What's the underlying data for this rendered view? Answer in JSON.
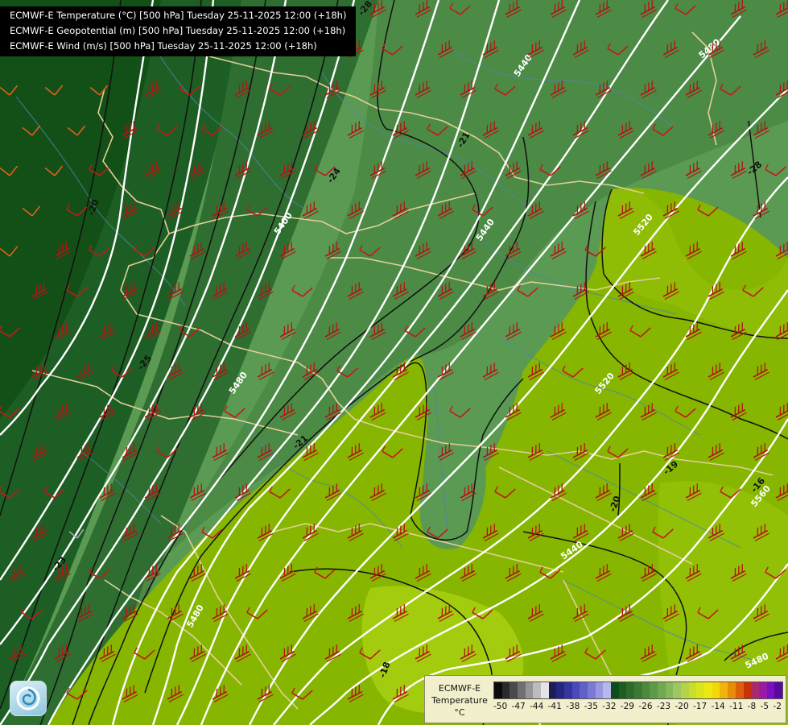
{
  "header": {
    "lines": [
      "ECMWF-E Temperature (°C) [500 hPa] Tuesday 25-11-2025 12:00 (+18h)",
      "ECMWF-E Geopotential (m) [500 hPa] Tuesday 25-11-2025 12:00 (+18h)",
      "ECMWF-E Wind (m/s) [500 hPa] Tuesday 25-11-2025 12:00 (+18h)"
    ]
  },
  "legend": {
    "title": [
      "ECMWF-E",
      "Temperature",
      "°C"
    ],
    "ticks": [
      "-50",
      "-47",
      "-44",
      "-41",
      "-38",
      "-35",
      "-32",
      "-29",
      "-26",
      "-23",
      "-20",
      "-17",
      "-14",
      "-11",
      "-8",
      "-5",
      "-2"
    ],
    "colors": [
      "#0b0b0b",
      "#2a2a2a",
      "#4a4a4a",
      "#707070",
      "#969696",
      "#bcbcbc",
      "#e4e4e4",
      "#1c1c58",
      "#262680",
      "#3535a0",
      "#4a4ab8",
      "#6060c8",
      "#7a7ad6",
      "#9898e2",
      "#b8b8ee",
      "#0c4d1c",
      "#1f5c20",
      "#2d6b2a",
      "#3c7a33",
      "#4d893c",
      "#5f9846",
      "#72a850",
      "#86b75a",
      "#9dc760",
      "#b3d348",
      "#c8dd2c",
      "#dce41c",
      "#ecea10",
      "#f4d80a",
      "#f0b40a",
      "#e88c0a",
      "#dc600a",
      "#c8320a",
      "#a82a6a",
      "#9a1aa8",
      "#7a10c0",
      "#5a08a0"
    ]
  },
  "map": {
    "geopotential_labels": [
      "5480",
      "5440",
      "5400",
      "5440",
      "5480",
      "5520",
      "5520",
      "5480",
      "5440",
      "5480",
      "5560"
    ],
    "temperature_labels": [
      "-28",
      "-24",
      "-21",
      "-21",
      "-23",
      "-25",
      "-28",
      "-18",
      "-20",
      "-16",
      "-20",
      "-19"
    ],
    "temperature_fill_colors": {
      "coldest": "#0d5417",
      "cold": "#226426",
      "mid": "#3a7a3c",
      "cool": "#4f8f4a",
      "mild": "#68a458",
      "warm": "#84b800",
      "warmer": "#9ec80a",
      "warmest": "#b7d818"
    },
    "wind_barb_colors": {
      "strong": "#b41414",
      "moderate": "#e0601a",
      "weak": "#a9a6ae"
    },
    "contour_colors": {
      "geopotential": "#ffffff",
      "temperature": "#111111",
      "borders": "#e3cf9a",
      "rivers": "#4d86a8"
    }
  }
}
